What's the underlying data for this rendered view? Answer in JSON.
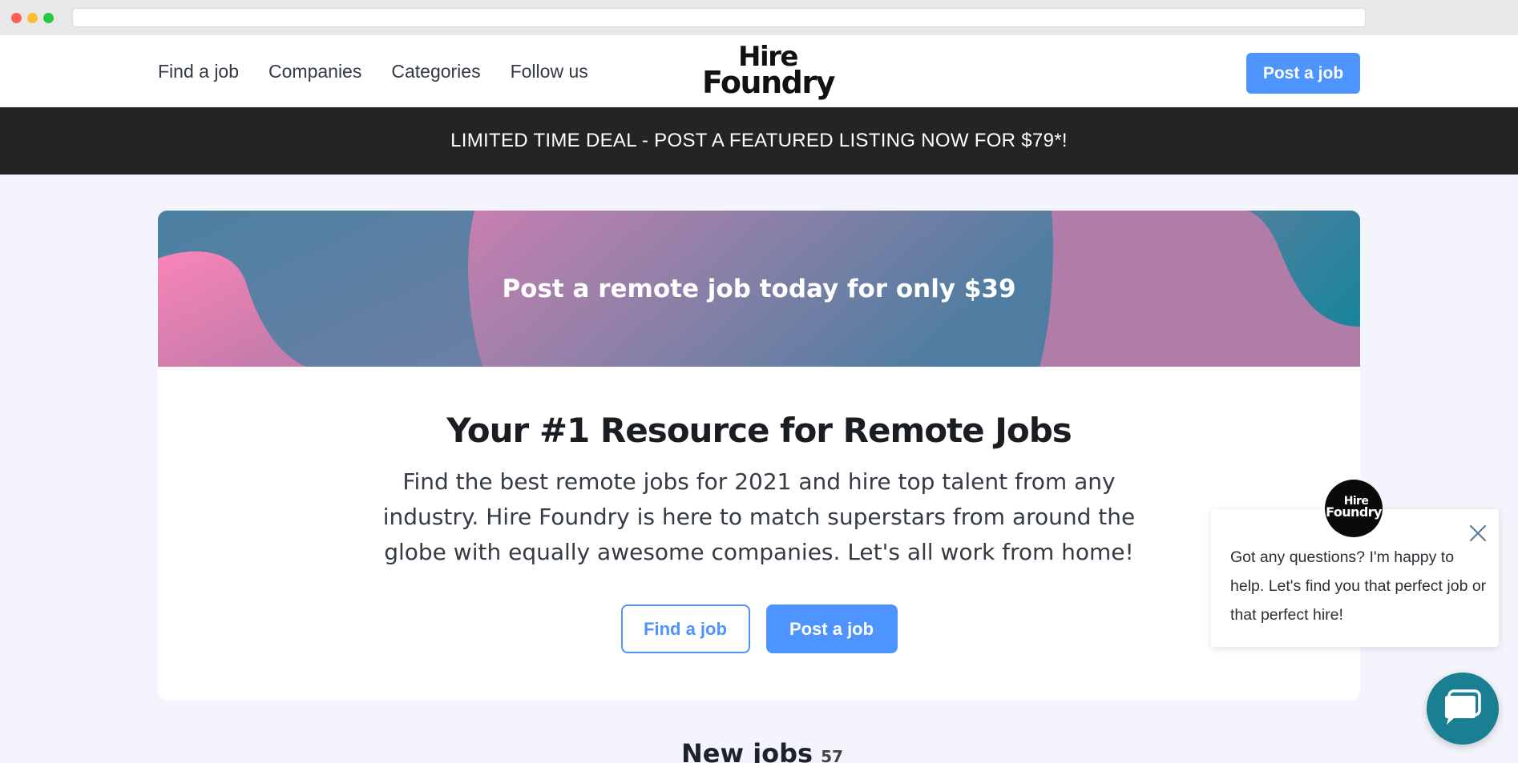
{
  "header": {
    "nav": [
      {
        "label": "Find a job"
      },
      {
        "label": "Companies"
      },
      {
        "label": "Categories"
      },
      {
        "label": "Follow us"
      }
    ],
    "logo": {
      "line1": "Hire",
      "line2": "Foundry"
    },
    "post_button": "Post a job"
  },
  "promo": {
    "text": "LIMITED TIME DEAL - POST A FEATURED LISTING NOW FOR $79*!"
  },
  "hero": {
    "banner_text": "Post a remote job today for only $39",
    "headline": "Your #1 Resource for Remote Jobs",
    "subtext": "Find the best remote jobs for 2021 and hire top talent from any industry. Hire Foundry is here to match superstars from around the globe with equally awesome companies. Let's all work from home!",
    "find_button": "Find a job",
    "post_button": "Post a job"
  },
  "new_jobs": {
    "title": "New jobs",
    "count": "57"
  },
  "chat": {
    "avatar": {
      "line1": "Hire",
      "line2": "Foundry"
    },
    "message": "Got any questions? I'm happy to help. Let's find you that perfect job or that perfect hire!",
    "close_icon": "close-icon",
    "launcher_icon": "chat-bubble-icon"
  },
  "colors": {
    "accent": "#4d94ff",
    "promo_bg": "#242424",
    "page_bg": "#f4f5fc",
    "chat_launcher": "#1a7f93"
  }
}
